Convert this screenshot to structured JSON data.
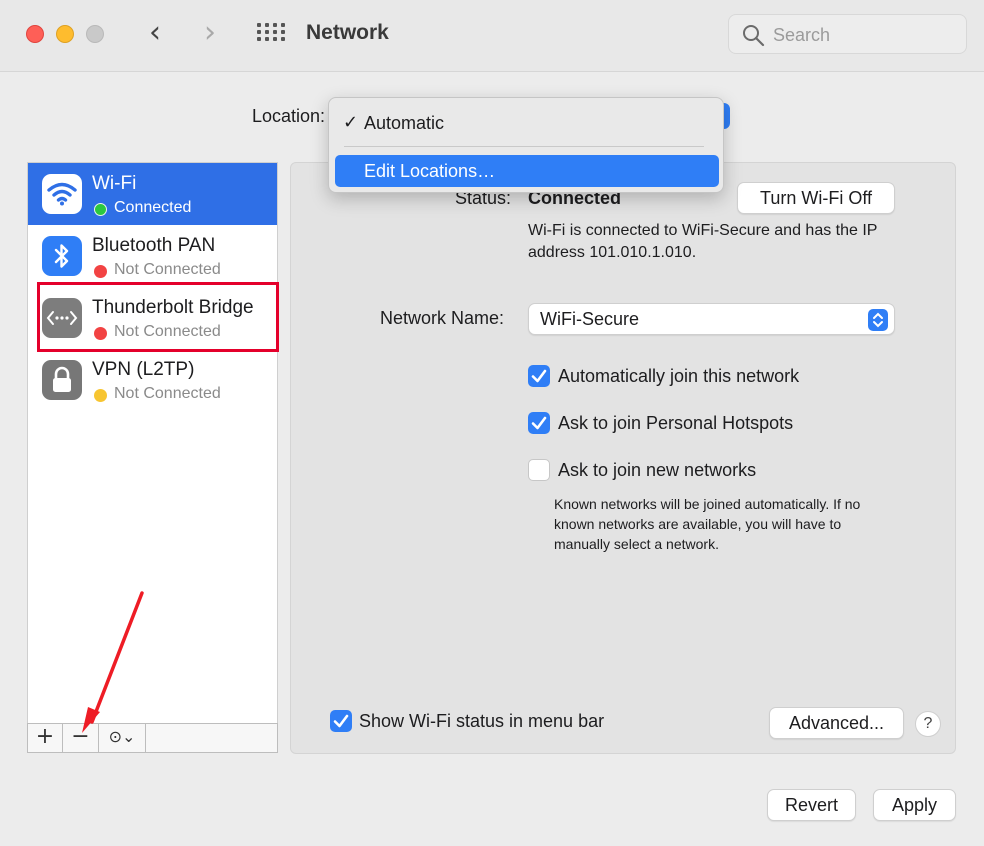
{
  "window": {
    "title": "Network"
  },
  "search": {
    "placeholder": "Search"
  },
  "location": {
    "label": "Location:",
    "menu": [
      {
        "label": "Automatic",
        "checked": true
      },
      {
        "label": "Edit Locations…",
        "highlighted": true
      }
    ]
  },
  "services": [
    {
      "name": "Wi-Fi",
      "status": "Connected",
      "status_color": "#2bc840",
      "icon": "wifi-icon",
      "selected": true
    },
    {
      "name": "Bluetooth PAN",
      "status": "Not Connected",
      "status_color": "#f24343",
      "icon": "bluetooth-icon"
    },
    {
      "name": "Thunderbolt Bridge",
      "status": "Not Connected",
      "status_color": "#f24343",
      "icon": "thunderbolt-bridge-icon",
      "annotated": true
    },
    {
      "name": "VPN (L2TP)",
      "status": "Not Connected",
      "status_color": "#f7c531",
      "icon": "lock-icon"
    }
  ],
  "sidebar_footer": {
    "add": "+",
    "remove": "−",
    "more": "⊙⌄"
  },
  "detail": {
    "status_label": "Status:",
    "status_value": "Connected",
    "status_desc": "Wi-Fi is connected to WiFi-Secure and has the IP address 101.010.1.010.",
    "turn_off_button": "Turn Wi-Fi Off",
    "network_name_label": "Network Name:",
    "network_name_value": "WiFi-Secure",
    "options": [
      {
        "label": "Automatically join this network",
        "checked": true
      },
      {
        "label": "Ask to join Personal Hotspots",
        "checked": true
      },
      {
        "label": "Ask to join new networks",
        "checked": false
      }
    ],
    "hint": "Known networks will be joined automatically. If no known networks are available, you will have to manually select a network.",
    "show_status_label": "Show Wi-Fi status in menu bar",
    "show_status_checked": true,
    "advanced_button": "Advanced...",
    "help_button": "?"
  },
  "footer": {
    "revert": "Revert",
    "apply": "Apply"
  },
  "colors": {
    "accent": "#2f7ef6",
    "annotation": "#e4002b"
  }
}
